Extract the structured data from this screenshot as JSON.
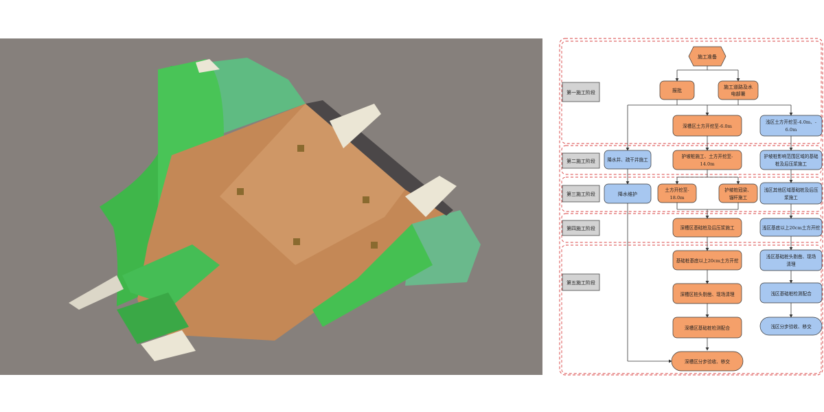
{
  "flowchart": {
    "start": "施工准备",
    "stages": [
      "第一施工阶段",
      "第二施工阶段",
      "第三施工阶段",
      "第四施工阶段",
      "第五施工阶段"
    ],
    "nodes": {
      "approval": "报批",
      "roads_water": [
        "施工道路及水",
        "电部署"
      ],
      "deep_excavate_6": "深槽区土方开挖至-6.0m",
      "shallow_excavate": [
        "浅区土方开挖至-4.0m、-",
        "6.0m"
      ],
      "dewatering_wells": "降水井、疏干井施工",
      "slope_piles": [
        "护坡桩施工、土方开挖至-",
        "14.0m"
      ],
      "shallow_piles": [
        "护坡桩影响范围区域的基础",
        "桩及后压浆施工"
      ],
      "dewatering": "降水维护",
      "excavate_18": [
        "土方开挖至-",
        "18.0m"
      ],
      "crown_beam": [
        "护坡桩冠梁、",
        "锚杆施工"
      ],
      "shallow_other_piles": [
        "浅区其他区域基础桩及后压",
        "浆施工"
      ],
      "deep_piles": "深槽区基础桩及后压浆施工",
      "shallow_excavate_20": "浅区基底以上20cm土方开挖",
      "deep_excavate_20": "基础桩基底以上20cm土方开挖",
      "shallow_pile_heads": [
        "浅区基础桩头剔凿、现场",
        "清理"
      ],
      "deep_pile_heads": "深槽区桩头剔凿、现场清理",
      "shallow_testing": "浅区基础桩检测配合",
      "deep_testing": "深槽区基础桩检测配合",
      "shallow_handover": "浅区分步验收、移交",
      "deep_handover": "深槽区分步验收、移交"
    },
    "colors": {
      "orange": "#f5a06a",
      "blue": "#a7c7f0",
      "stage_label": "#d3d3d3",
      "stage_border": "#d94444"
    }
  }
}
